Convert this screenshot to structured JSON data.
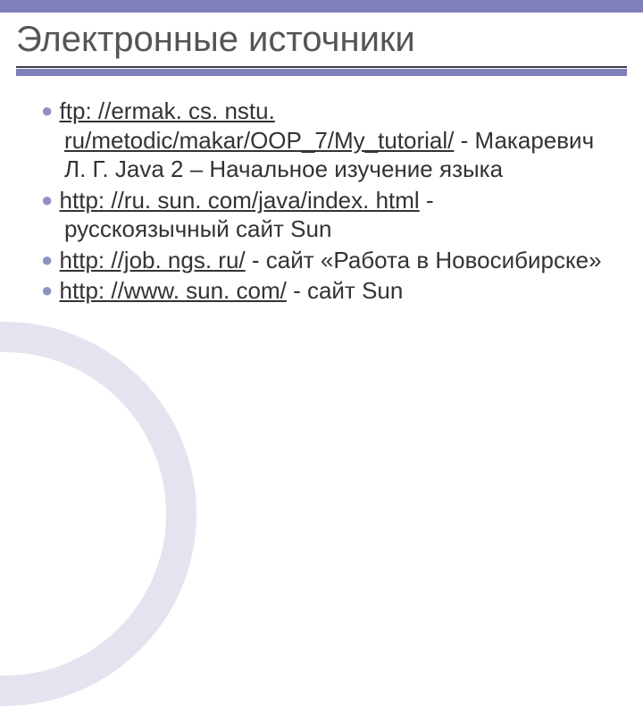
{
  "colors": {
    "band": "#7d80b9",
    "bullet": "#8e91c4",
    "arc": "#e3e4ef",
    "text": "#333333",
    "heading": "#555555"
  },
  "heading": "Электронные источники",
  "items": [
    {
      "link_text": "ftp: //ermak. cs. nstu. ru/metodic/makar/OOP_7/My_tutorial/",
      "rest": " - Макаревич Л. Г. Java 2 – Начальное изучение языка"
    },
    {
      "link_text": "http: //ru. sun. com/java/index. html",
      "rest": " - русскоязычный сайт Sun"
    },
    {
      "link_text": "http: //job. ngs. ru/",
      "rest": " - сайт «Работа в Новосибирске»"
    },
    {
      "link_text": "http: //www. sun. com/",
      "rest": " - сайт Sun"
    }
  ],
  "bullet_char": "●"
}
